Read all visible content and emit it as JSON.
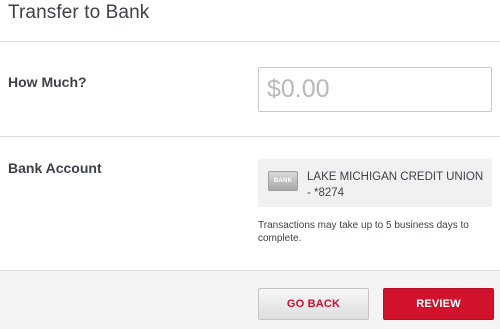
{
  "header": {
    "title": "Transfer to Bank"
  },
  "amount": {
    "label": "How Much?",
    "placeholder": "$0.00"
  },
  "bank": {
    "label": "Bank Account",
    "logo_text": "BANK",
    "account_name": "LAKE MICHIGAN CREDIT UNION - *8274",
    "note": "Transactions may take up to 5 business days to complete."
  },
  "footer": {
    "back_label": "GO BACK",
    "review_label": "REVIEW"
  },
  "colors": {
    "accent": "#d0122c",
    "text": "#3d4248",
    "divider": "#dcdcdc"
  }
}
